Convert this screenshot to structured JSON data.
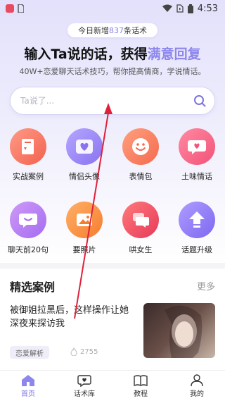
{
  "statusbar": {
    "time": "4:53",
    "icons": [
      "app-badge-icon",
      "sim-icon",
      "wifi-icon",
      "no-sim-icon",
      "battery-icon"
    ]
  },
  "banner": {
    "prefix": "今日新增",
    "count": "837",
    "suffix": "条话术"
  },
  "headline": {
    "text": "输入Ta说的话，获得",
    "highlight": "满意回复"
  },
  "subline": "40W+恋爱聊天话术技巧，帮你提高情商，学说情话。",
  "search": {
    "placeholder": "Ta说了...",
    "icon": "search-icon"
  },
  "categories": [
    {
      "label": "实战案例",
      "icon": "book-icon",
      "color": "#f2624e"
    },
    {
      "label": "情侣头像",
      "icon": "heart-icon",
      "color": "#8a73f0"
    },
    {
      "label": "表情包",
      "icon": "smile-icon",
      "color": "#f56a4e"
    },
    {
      "label": "土味情话",
      "icon": "chat-heart-icon",
      "color": "#f2527a"
    },
    {
      "label": "聊天前20句",
      "icon": "chat-icon",
      "color": "#a36cf0"
    },
    {
      "label": "要照片",
      "icon": "photo-icon",
      "color": "#f57d2e"
    },
    {
      "label": "哄女生",
      "icon": "chat-bubbles-icon",
      "color": "#e63a5a"
    },
    {
      "label": "话题升级",
      "icon": "upgrade-arrow-icon",
      "color": "#7d68f0"
    }
  ],
  "featured": {
    "title": "精选案例",
    "more": "更多",
    "article": {
      "title": "被御姐拉黑后，这样操作让她深夜来探访我",
      "tag": "恋爱解析",
      "views": "2755"
    }
  },
  "nav": [
    {
      "label": "首页",
      "icon": "home-icon",
      "active": true
    },
    {
      "label": "话术库",
      "icon": "heart-chat-icon",
      "active": false
    },
    {
      "label": "教程",
      "icon": "open-book-icon",
      "active": false
    },
    {
      "label": "我的",
      "icon": "person-icon",
      "active": false
    }
  ],
  "accent": "#8d86ec"
}
